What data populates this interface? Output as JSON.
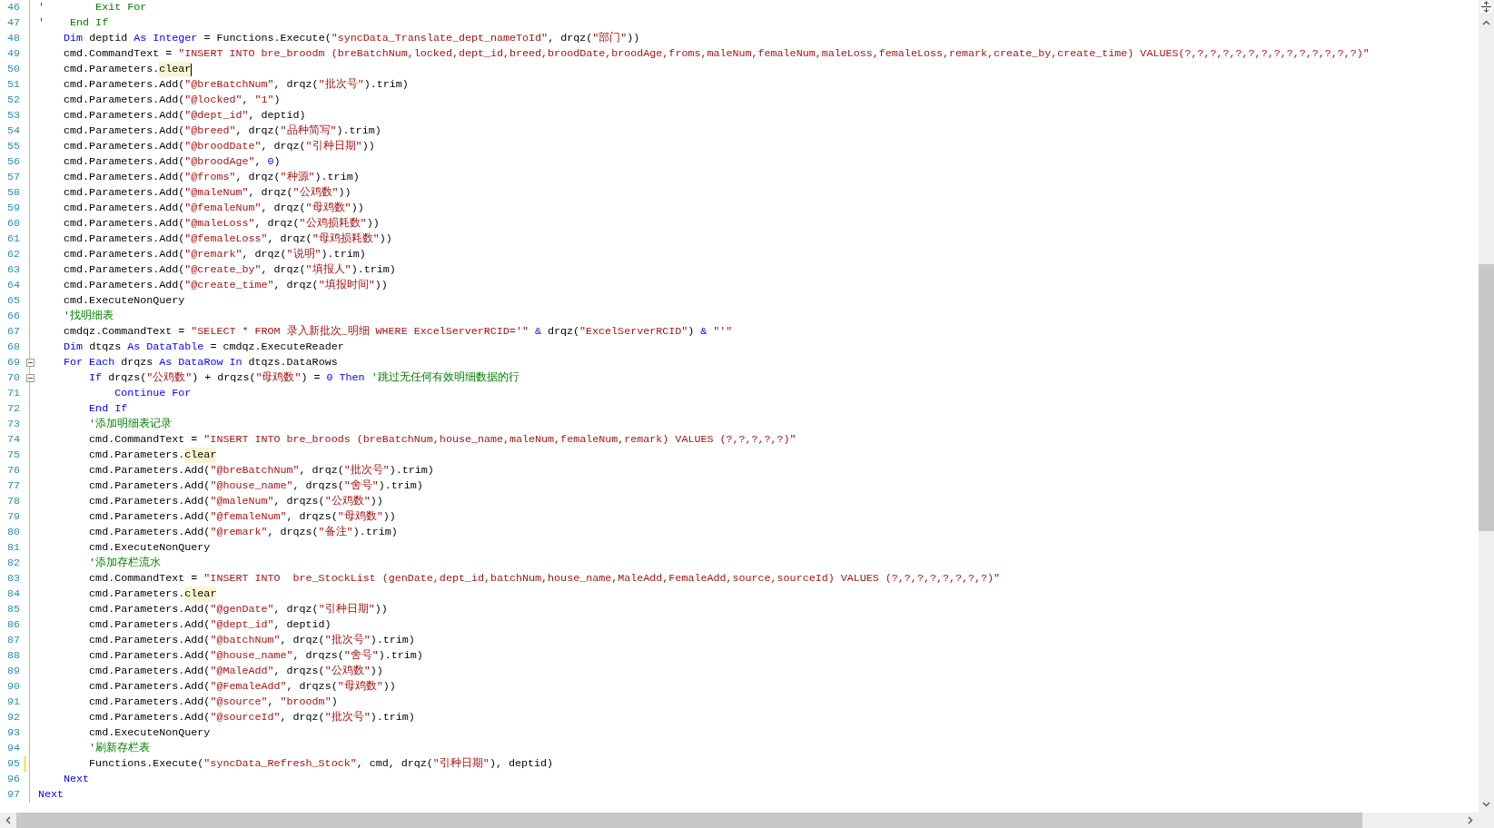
{
  "editor": {
    "lines": [
      {
        "number": "46",
        "tokens": [
          {
            "kind": "comment",
            "text": "'        Exit For"
          }
        ]
      },
      {
        "number": "47",
        "tokens": [
          {
            "kind": "comment",
            "text": "'    End If"
          }
        ]
      },
      {
        "number": "48",
        "tokens": [
          {
            "kind": "keyword",
            "text": "    Dim"
          },
          {
            "kind": "plain",
            "text": " deptid "
          },
          {
            "kind": "keyword",
            "text": "As Integer"
          },
          {
            "kind": "plain",
            "text": " = Functions.Execute("
          },
          {
            "kind": "string",
            "text": "\"syncData_Translate_dept_nameToId\""
          },
          {
            "kind": "plain",
            "text": ", drqz("
          },
          {
            "kind": "string",
            "text": "\"部门\""
          },
          {
            "kind": "plain",
            "text": "))"
          }
        ]
      },
      {
        "number": "49",
        "tokens": [
          {
            "kind": "plain",
            "text": "    cmd.CommandText = "
          },
          {
            "kind": "string",
            "text": "\"INSERT INTO bre_broodm (breBatchNum,locked,dept_id,breed,broodDate,broodAge,froms,maleNum,femaleNum,maleLoss,femaleLoss,remark,create_by,create_time) VALUES(?,?,?,?,?,?,?,?,?,?,?,?,?,?)\""
          }
        ]
      },
      {
        "number": "50",
        "cursor": true,
        "tokens": [
          {
            "kind": "plain",
            "text": "    cmd.Parameters."
          },
          {
            "kind": "highlight",
            "text": "clear"
          }
        ]
      },
      {
        "number": "51",
        "tokens": [
          {
            "kind": "plain",
            "text": "    cmd.Parameters.Add("
          },
          {
            "kind": "string",
            "text": "\"@breBatchNum\""
          },
          {
            "kind": "plain",
            "text": ", drqz("
          },
          {
            "kind": "string",
            "text": "\"批次号\""
          },
          {
            "kind": "plain",
            "text": ").trim)"
          }
        ]
      },
      {
        "number": "52",
        "tokens": [
          {
            "kind": "plain",
            "text": "    cmd.Parameters.Add("
          },
          {
            "kind": "string",
            "text": "\"@locked\""
          },
          {
            "kind": "plain",
            "text": ", "
          },
          {
            "kind": "string",
            "text": "\"1\""
          },
          {
            "kind": "plain",
            "text": ")"
          }
        ]
      },
      {
        "number": "53",
        "tokens": [
          {
            "kind": "plain",
            "text": "    cmd.Parameters.Add("
          },
          {
            "kind": "string",
            "text": "\"@dept_id\""
          },
          {
            "kind": "plain",
            "text": ", deptid)"
          }
        ]
      },
      {
        "number": "54",
        "tokens": [
          {
            "kind": "plain",
            "text": "    cmd.Parameters.Add("
          },
          {
            "kind": "string",
            "text": "\"@breed\""
          },
          {
            "kind": "plain",
            "text": ", drqz("
          },
          {
            "kind": "string",
            "text": "\"品种简写\""
          },
          {
            "kind": "plain",
            "text": ").trim)"
          }
        ]
      },
      {
        "number": "55",
        "tokens": [
          {
            "kind": "plain",
            "text": "    cmd.Parameters.Add("
          },
          {
            "kind": "string",
            "text": "\"@broodDate\""
          },
          {
            "kind": "plain",
            "text": ", drqz("
          },
          {
            "kind": "string",
            "text": "\"引种日期\""
          },
          {
            "kind": "plain",
            "text": "))"
          }
        ]
      },
      {
        "number": "56",
        "tokens": [
          {
            "kind": "plain",
            "text": "    cmd.Parameters.Add("
          },
          {
            "kind": "string",
            "text": "\"@broodAge\""
          },
          {
            "kind": "plain",
            "text": ", "
          },
          {
            "kind": "number",
            "text": "0"
          },
          {
            "kind": "plain",
            "text": ")"
          }
        ]
      },
      {
        "number": "57",
        "tokens": [
          {
            "kind": "plain",
            "text": "    cmd.Parameters.Add("
          },
          {
            "kind": "string",
            "text": "\"@froms\""
          },
          {
            "kind": "plain",
            "text": ", drqz("
          },
          {
            "kind": "string",
            "text": "\"种源\""
          },
          {
            "kind": "plain",
            "text": ").trim)"
          }
        ]
      },
      {
        "number": "58",
        "tokens": [
          {
            "kind": "plain",
            "text": "    cmd.Parameters.Add("
          },
          {
            "kind": "string",
            "text": "\"@maleNum\""
          },
          {
            "kind": "plain",
            "text": ", drqz("
          },
          {
            "kind": "string",
            "text": "\"公鸡数\""
          },
          {
            "kind": "plain",
            "text": "))"
          }
        ]
      },
      {
        "number": "59",
        "tokens": [
          {
            "kind": "plain",
            "text": "    cmd.Parameters.Add("
          },
          {
            "kind": "string",
            "text": "\"@femaleNum\""
          },
          {
            "kind": "plain",
            "text": ", drqz("
          },
          {
            "kind": "string",
            "text": "\"母鸡数\""
          },
          {
            "kind": "plain",
            "text": "))"
          }
        ]
      },
      {
        "number": "60",
        "tokens": [
          {
            "kind": "plain",
            "text": "    cmd.Parameters.Add("
          },
          {
            "kind": "string",
            "text": "\"@maleLoss\""
          },
          {
            "kind": "plain",
            "text": ", drqz("
          },
          {
            "kind": "string",
            "text": "\"公鸡损耗数\""
          },
          {
            "kind": "plain",
            "text": "))"
          }
        ]
      },
      {
        "number": "61",
        "tokens": [
          {
            "kind": "plain",
            "text": "    cmd.Parameters.Add("
          },
          {
            "kind": "string",
            "text": "\"@femaleLoss\""
          },
          {
            "kind": "plain",
            "text": ", drqz("
          },
          {
            "kind": "string",
            "text": "\"母鸡损耗数\""
          },
          {
            "kind": "plain",
            "text": "))"
          }
        ]
      },
      {
        "number": "62",
        "tokens": [
          {
            "kind": "plain",
            "text": "    cmd.Parameters.Add("
          },
          {
            "kind": "string",
            "text": "\"@remark\""
          },
          {
            "kind": "plain",
            "text": ", drqz("
          },
          {
            "kind": "string",
            "text": "\"说明\""
          },
          {
            "kind": "plain",
            "text": ").trim)"
          }
        ]
      },
      {
        "number": "63",
        "tokens": [
          {
            "kind": "plain",
            "text": "    cmd.Parameters.Add("
          },
          {
            "kind": "string",
            "text": "\"@create_by\""
          },
          {
            "kind": "plain",
            "text": ", drqz("
          },
          {
            "kind": "string",
            "text": "\"填报人\""
          },
          {
            "kind": "plain",
            "text": ").trim)"
          }
        ]
      },
      {
        "number": "64",
        "tokens": [
          {
            "kind": "plain",
            "text": "    cmd.Parameters.Add("
          },
          {
            "kind": "string",
            "text": "\"@create_time\""
          },
          {
            "kind": "plain",
            "text": ", drqz("
          },
          {
            "kind": "string",
            "text": "\"填报时间\""
          },
          {
            "kind": "plain",
            "text": "))"
          }
        ]
      },
      {
        "number": "65",
        "tokens": [
          {
            "kind": "plain",
            "text": "    cmd.ExecuteNonQuery"
          }
        ]
      },
      {
        "number": "66",
        "tokens": [
          {
            "kind": "comment",
            "text": "    '找明细表"
          }
        ]
      },
      {
        "number": "67",
        "tokens": [
          {
            "kind": "plain",
            "text": "    cmdqz.CommandText = "
          },
          {
            "kind": "string",
            "text": "\"SELECT * FROM 录入新批次_明细 WHERE ExcelServerRCID='\""
          },
          {
            "kind": "keyword",
            "text": " & "
          },
          {
            "kind": "plain",
            "text": "drqz("
          },
          {
            "kind": "string",
            "text": "\"ExcelServerRCID\""
          },
          {
            "kind": "plain",
            "text": ")"
          },
          {
            "kind": "keyword",
            "text": " & "
          },
          {
            "kind": "string",
            "text": "\"'\""
          }
        ]
      },
      {
        "number": "68",
        "tokens": [
          {
            "kind": "keyword",
            "text": "    Dim"
          },
          {
            "kind": "plain",
            "text": " dtqzs "
          },
          {
            "kind": "keyword",
            "text": "As DataTable"
          },
          {
            "kind": "plain",
            "text": " = cmdqz.ExecuteReader"
          }
        ]
      },
      {
        "number": "69",
        "folded": false,
        "tokens": [
          {
            "kind": "keyword",
            "text": "    For Each"
          },
          {
            "kind": "plain",
            "text": " drqzs "
          },
          {
            "kind": "keyword",
            "text": "As DataRow In"
          },
          {
            "kind": "plain",
            "text": " dtqzs.DataRows"
          }
        ]
      },
      {
        "number": "70",
        "folded": false,
        "tokens": [
          {
            "kind": "keyword",
            "text": "        If"
          },
          {
            "kind": "plain",
            "text": " drqzs("
          },
          {
            "kind": "string",
            "text": "\"公鸡数\""
          },
          {
            "kind": "plain",
            "text": ") + drqzs("
          },
          {
            "kind": "string",
            "text": "\"母鸡数\""
          },
          {
            "kind": "plain",
            "text": ") = "
          },
          {
            "kind": "number",
            "text": "0"
          },
          {
            "kind": "keyword",
            "text": " Then "
          },
          {
            "kind": "comment",
            "text": "'跳过无任何有效明细数据的行"
          }
        ]
      },
      {
        "number": "71",
        "tokens": [
          {
            "kind": "keyword",
            "text": "            Continue For"
          }
        ]
      },
      {
        "number": "72",
        "tokens": [
          {
            "kind": "keyword",
            "text": "        End If"
          }
        ]
      },
      {
        "number": "73",
        "tokens": [
          {
            "kind": "comment",
            "text": "        '添加明细表记录"
          }
        ]
      },
      {
        "number": "74",
        "tokens": [
          {
            "kind": "plain",
            "text": "        cmd.CommandText = "
          },
          {
            "kind": "string",
            "text": "\"INSERT INTO bre_broods (breBatchNum,house_name,maleNum,femaleNum,remark) VALUES (?,?,?,?,?)\""
          }
        ]
      },
      {
        "number": "75",
        "tokens": [
          {
            "kind": "plain",
            "text": "        cmd.Parameters."
          },
          {
            "kind": "highlight",
            "text": "clear"
          }
        ]
      },
      {
        "number": "76",
        "tokens": [
          {
            "kind": "plain",
            "text": "        cmd.Parameters.Add("
          },
          {
            "kind": "string",
            "text": "\"@breBatchNum\""
          },
          {
            "kind": "plain",
            "text": ", drqz("
          },
          {
            "kind": "string",
            "text": "\"批次号\""
          },
          {
            "kind": "plain",
            "text": ").trim)"
          }
        ]
      },
      {
        "number": "77",
        "tokens": [
          {
            "kind": "plain",
            "text": "        cmd.Parameters.Add("
          },
          {
            "kind": "string",
            "text": "\"@house_name\""
          },
          {
            "kind": "plain",
            "text": ", drqzs("
          },
          {
            "kind": "string",
            "text": "\"舍号\""
          },
          {
            "kind": "plain",
            "text": ").trim)"
          }
        ]
      },
      {
        "number": "78",
        "tokens": [
          {
            "kind": "plain",
            "text": "        cmd.Parameters.Add("
          },
          {
            "kind": "string",
            "text": "\"@maleNum\""
          },
          {
            "kind": "plain",
            "text": ", drqzs("
          },
          {
            "kind": "string",
            "text": "\"公鸡数\""
          },
          {
            "kind": "plain",
            "text": "))"
          }
        ]
      },
      {
        "number": "79",
        "tokens": [
          {
            "kind": "plain",
            "text": "        cmd.Parameters.Add("
          },
          {
            "kind": "string",
            "text": "\"@femaleNum\""
          },
          {
            "kind": "plain",
            "text": ", drqzs("
          },
          {
            "kind": "string",
            "text": "\"母鸡数\""
          },
          {
            "kind": "plain",
            "text": "))"
          }
        ]
      },
      {
        "number": "80",
        "tokens": [
          {
            "kind": "plain",
            "text": "        cmd.Parameters.Add("
          },
          {
            "kind": "string",
            "text": "\"@remark\""
          },
          {
            "kind": "plain",
            "text": ", drqzs("
          },
          {
            "kind": "string",
            "text": "\"备注\""
          },
          {
            "kind": "plain",
            "text": ").trim)"
          }
        ]
      },
      {
        "number": "81",
        "tokens": [
          {
            "kind": "plain",
            "text": "        cmd.ExecuteNonQuery"
          }
        ]
      },
      {
        "number": "82",
        "tokens": [
          {
            "kind": "comment",
            "text": "        '添加存栏流水"
          }
        ]
      },
      {
        "number": "83",
        "tokens": [
          {
            "kind": "plain",
            "text": "        cmd.CommandText = "
          },
          {
            "kind": "string",
            "text": "\"INSERT INTO  bre_StockList (genDate,dept_id,batchNum,house_name,MaleAdd,FemaleAdd,source,sourceId) VALUES (?,?,?,?,?,?,?,?)\""
          }
        ]
      },
      {
        "number": "84",
        "tokens": [
          {
            "kind": "plain",
            "text": "        cmd.Parameters."
          },
          {
            "kind": "highlight",
            "text": "clear"
          }
        ]
      },
      {
        "number": "85",
        "tokens": [
          {
            "kind": "plain",
            "text": "        cmd.Parameters.Add("
          },
          {
            "kind": "string",
            "text": "\"@genDate\""
          },
          {
            "kind": "plain",
            "text": ", drqz("
          },
          {
            "kind": "string",
            "text": "\"引种日期\""
          },
          {
            "kind": "plain",
            "text": "))"
          }
        ]
      },
      {
        "number": "86",
        "tokens": [
          {
            "kind": "plain",
            "text": "        cmd.Parameters.Add("
          },
          {
            "kind": "string",
            "text": "\"@dept_id\""
          },
          {
            "kind": "plain",
            "text": ", deptid)"
          }
        ]
      },
      {
        "number": "87",
        "tokens": [
          {
            "kind": "plain",
            "text": "        cmd.Parameters.Add("
          },
          {
            "kind": "string",
            "text": "\"@batchNum\""
          },
          {
            "kind": "plain",
            "text": ", drqz("
          },
          {
            "kind": "string",
            "text": "\"批次号\""
          },
          {
            "kind": "plain",
            "text": ").trim)"
          }
        ]
      },
      {
        "number": "88",
        "tokens": [
          {
            "kind": "plain",
            "text": "        cmd.Parameters.Add("
          },
          {
            "kind": "string",
            "text": "\"@house_name\""
          },
          {
            "kind": "plain",
            "text": ", drqzs("
          },
          {
            "kind": "string",
            "text": "\"舍号\""
          },
          {
            "kind": "plain",
            "text": ").trim)"
          }
        ]
      },
      {
        "number": "89",
        "tokens": [
          {
            "kind": "plain",
            "text": "        cmd.Parameters.Add("
          },
          {
            "kind": "string",
            "text": "\"@MaleAdd\""
          },
          {
            "kind": "plain",
            "text": ", drqzs("
          },
          {
            "kind": "string",
            "text": "\"公鸡数\""
          },
          {
            "kind": "plain",
            "text": "))"
          }
        ]
      },
      {
        "number": "90",
        "tokens": [
          {
            "kind": "plain",
            "text": "        cmd.Parameters.Add("
          },
          {
            "kind": "string",
            "text": "\"@FemaleAdd\""
          },
          {
            "kind": "plain",
            "text": ", drqzs("
          },
          {
            "kind": "string",
            "text": "\"母鸡数\""
          },
          {
            "kind": "plain",
            "text": "))"
          }
        ]
      },
      {
        "number": "91",
        "tokens": [
          {
            "kind": "plain",
            "text": "        cmd.Parameters.Add("
          },
          {
            "kind": "string",
            "text": "\"@source\""
          },
          {
            "kind": "plain",
            "text": ", "
          },
          {
            "kind": "string",
            "text": "\"broodm\""
          },
          {
            "kind": "plain",
            "text": ")"
          }
        ]
      },
      {
        "number": "92",
        "tokens": [
          {
            "kind": "plain",
            "text": "        cmd.Parameters.Add("
          },
          {
            "kind": "string",
            "text": "\"@sourceId\""
          },
          {
            "kind": "plain",
            "text": ", drqz("
          },
          {
            "kind": "string",
            "text": "\"批次号\""
          },
          {
            "kind": "plain",
            "text": ").trim)"
          }
        ]
      },
      {
        "number": "93",
        "tokens": [
          {
            "kind": "plain",
            "text": "        cmd.ExecuteNonQuery"
          }
        ]
      },
      {
        "number": "94",
        "tokens": [
          {
            "kind": "comment",
            "text": "        '刷新存栏表"
          }
        ]
      },
      {
        "number": "95",
        "modified": true,
        "tokens": [
          {
            "kind": "plain",
            "text": "        Functions.Execute("
          },
          {
            "kind": "string",
            "text": "\"syncData_Refresh_Stock\""
          },
          {
            "kind": "plain",
            "text": ", cmd, drqz("
          },
          {
            "kind": "string",
            "text": "\"引种日期\""
          },
          {
            "kind": "plain",
            "text": "), deptid)"
          }
        ]
      },
      {
        "number": "96",
        "tokens": [
          {
            "kind": "keyword",
            "text": "    Next"
          }
        ]
      },
      {
        "number": "97",
        "tokens": [
          {
            "kind": "keyword",
            "text": "Next"
          }
        ]
      }
    ]
  }
}
